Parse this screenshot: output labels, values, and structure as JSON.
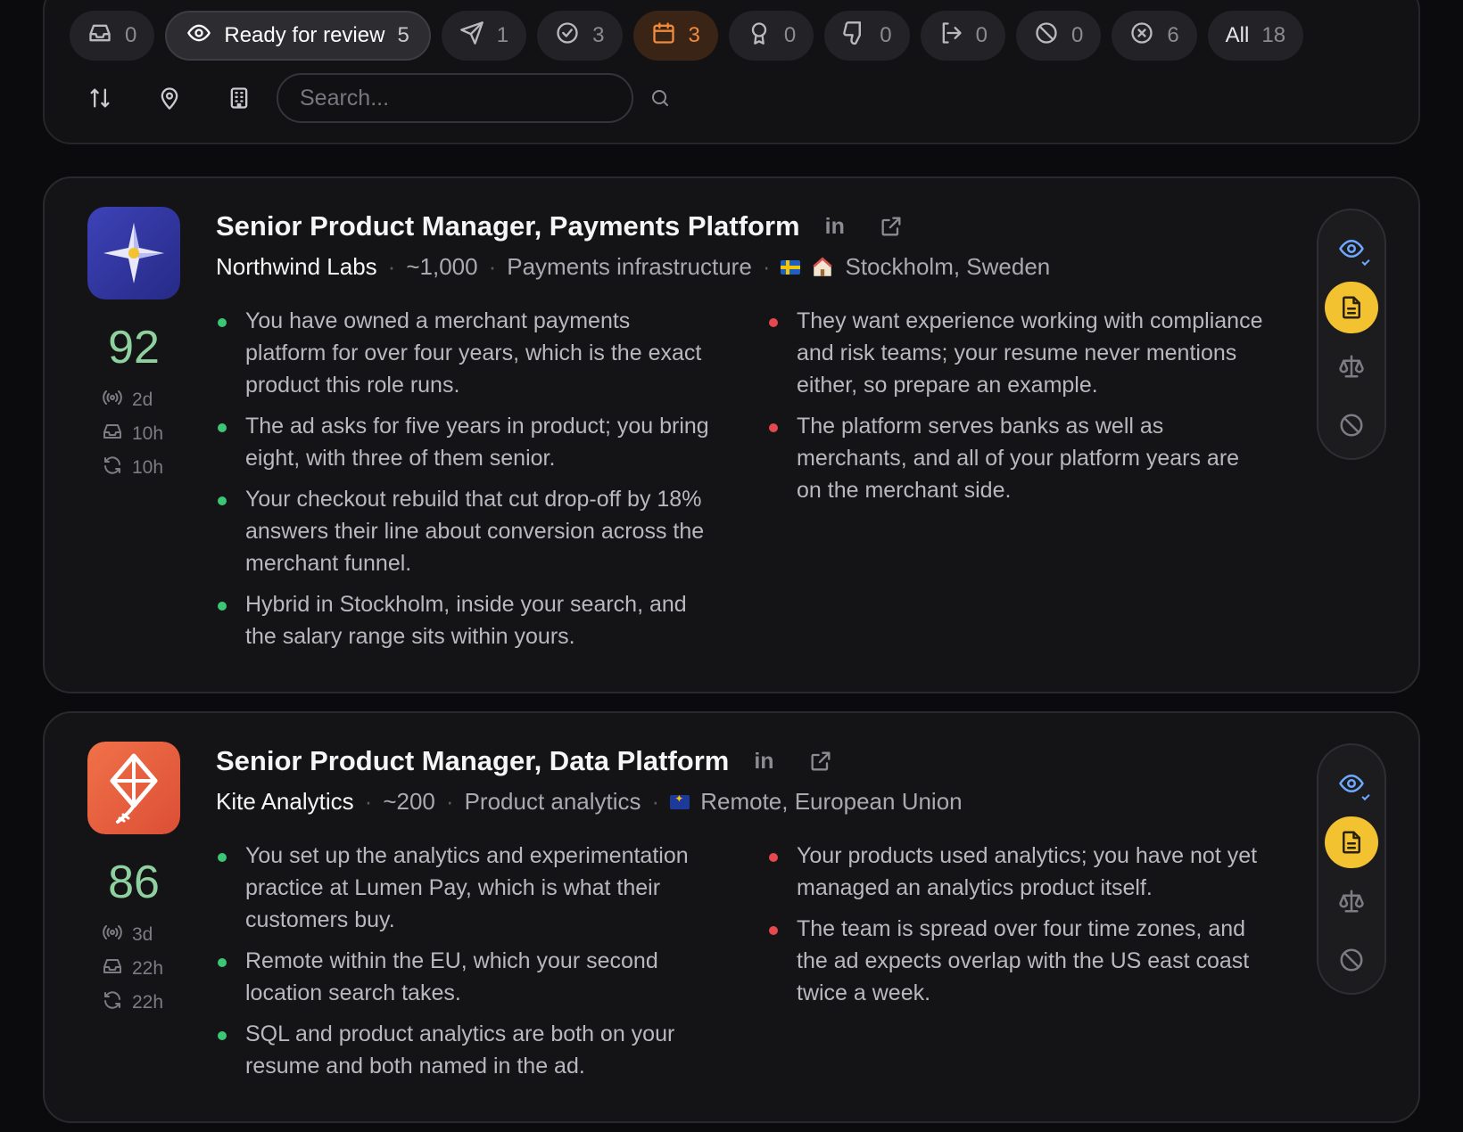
{
  "filters": {
    "pills": [
      {
        "icon": "inbox-icon",
        "label": "",
        "count": "0",
        "state": "default"
      },
      {
        "icon": "eye-icon",
        "label": "Ready for review",
        "count": "5",
        "state": "active"
      },
      {
        "icon": "send-icon",
        "label": "",
        "count": "1",
        "state": "default"
      },
      {
        "icon": "check-circle-icon",
        "label": "",
        "count": "3",
        "state": "default"
      },
      {
        "icon": "calendar-icon",
        "label": "",
        "count": "3",
        "state": "highlighted",
        "color": "#f08a3c"
      },
      {
        "icon": "award-icon",
        "label": "",
        "count": "0",
        "state": "default"
      },
      {
        "icon": "thumbs-down-icon",
        "label": "",
        "count": "0",
        "state": "default"
      },
      {
        "icon": "log-out-icon",
        "label": "",
        "count": "0",
        "state": "default"
      },
      {
        "icon": "ban-icon",
        "label": "",
        "count": "0",
        "state": "default"
      },
      {
        "icon": "x-circle-icon",
        "label": "",
        "count": "6",
        "state": "default"
      },
      {
        "icon": "",
        "label": "All",
        "count": "18",
        "state": "default"
      }
    ],
    "tools": [
      "sort-icon",
      "location-pin-icon",
      "building-icon"
    ],
    "search": {
      "placeholder": "Search...",
      "value": ""
    }
  },
  "jobs": [
    {
      "title": "Senior Product Manager, Payments Platform",
      "company": "Northwind Labs",
      "size": "~1,000",
      "industry": "Payments infrastructure",
      "location": "Stockholm, Sweden",
      "flag": "sweden-flag-icon",
      "score": "92",
      "posted": "2d",
      "received": "10h",
      "updated": "10h",
      "logo_colors": [
        "#3a3fb0",
        "#2a2d8a"
      ],
      "pros": [
        "You have owned a merchant payments platform for over four years, which is the exact product this role runs.",
        "The ad asks for five years in product; you bring eight, with three of them senior.",
        "Your checkout rebuild that cut drop-off by 18% answers their line about conversion across the merchant funnel.",
        "Hybrid in Stockholm, inside your search, and the salary range sits within yours."
      ],
      "cons": [
        "They want experience working with compliance and risk teams; your resume never mentions either, so prepare an example.",
        "The platform serves banks as well as merchants, and all of your platform years are on the merchant side."
      ]
    },
    {
      "title": "Senior Product Manager, Data Platform",
      "company": "Kite Analytics",
      "size": "~200",
      "industry": "Product analytics",
      "location": "Remote, European Union",
      "flag": "eu-flag-icon",
      "score": "86",
      "posted": "3d",
      "received": "22h",
      "updated": "22h",
      "logo_colors": [
        "#ef6a45",
        "#e0533a"
      ],
      "pros": [
        "You set up the analytics and experimentation practice at Lumen Pay, which is what their customers buy.",
        "Remote within the EU, which your second location search takes.",
        "SQL and product analytics are both on your resume and both named in the ad."
      ],
      "cons": [
        "Your products used analytics; you have not yet managed an analytics product itself.",
        "The team is spread over four time zones, and the ad expects overlap with the US east coast twice a week."
      ]
    }
  ],
  "title_links": {
    "linkedin_label": "in"
  }
}
